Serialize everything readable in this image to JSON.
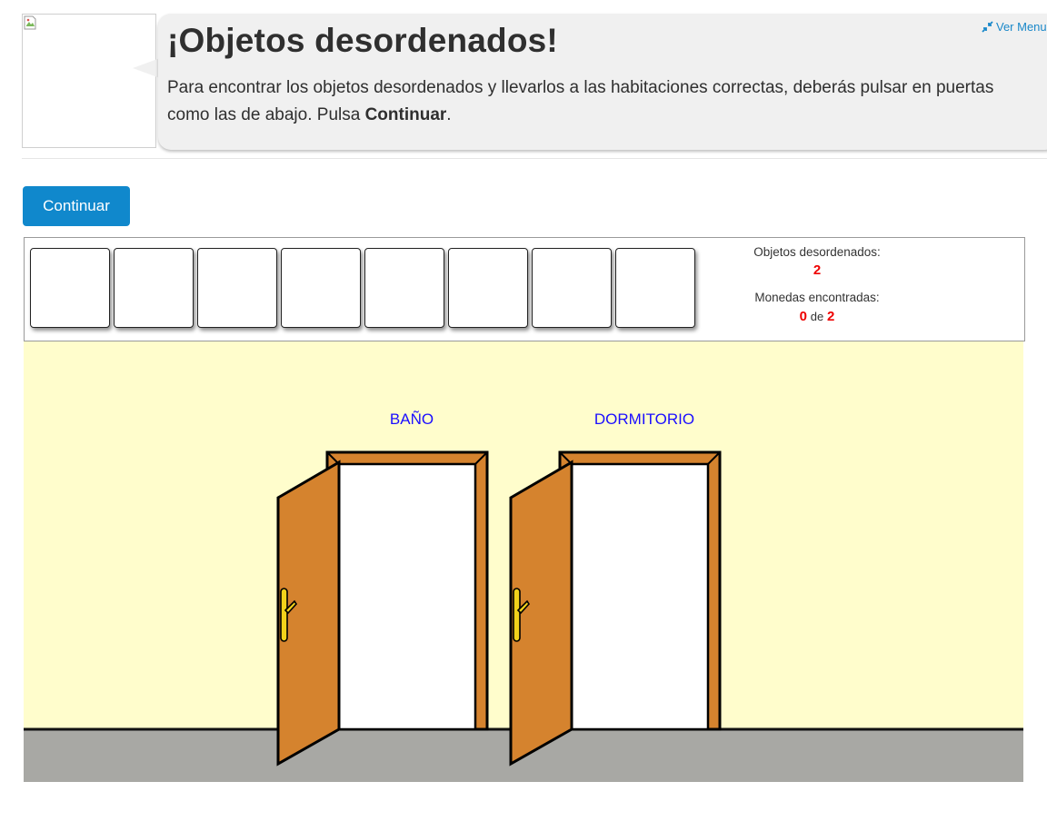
{
  "header": {
    "title": "¡Objetos desordenados!",
    "instruction_part1": "Para encontrar los objetos desordenados y llevarlos a las habitaciones correctas, deberás pulsar en puertas como las de abajo. Pulsa ",
    "instruction_bold": "Continuar",
    "instruction_part2": ".",
    "menu_link": "Ver Menu",
    "menu_icon": "compress-arrows-icon",
    "avatar_icon": "broken-image-icon"
  },
  "actions": {
    "continue_label": "Continuar"
  },
  "inventory": {
    "slots": [
      "",
      "",
      "",
      "",
      "",
      "",
      "",
      ""
    ]
  },
  "stats": {
    "messy_label": "Objetos desordenados:",
    "messy_count": "2",
    "coins_label": "Monedas encontradas:",
    "coins_found": "0",
    "coins_of": "de",
    "coins_total": "2"
  },
  "scene": {
    "rooms": [
      {
        "label": "BAÑO"
      },
      {
        "label": "DORMITORIO"
      }
    ],
    "colors": {
      "wall": "#fffdcc",
      "floor": "#a8a8a4",
      "door": "#d5832e",
      "handle": "#f2d21b",
      "accent_button": "#1088cc",
      "room_label": "#1a0dff",
      "stat_number": "#ee0000"
    }
  }
}
